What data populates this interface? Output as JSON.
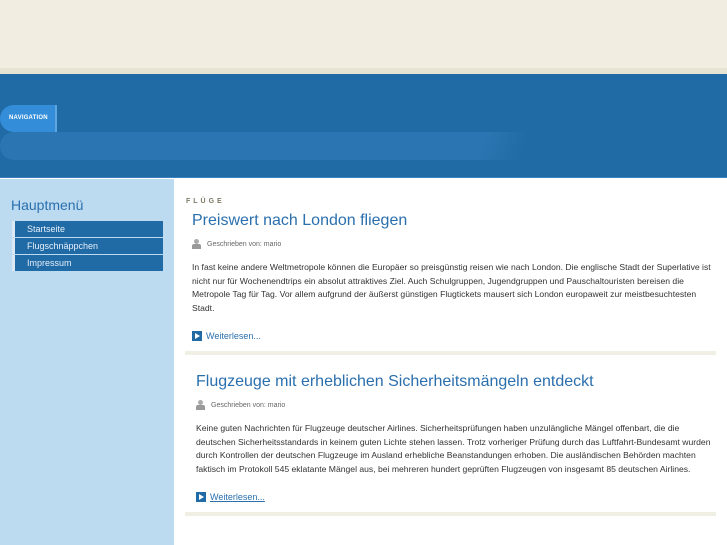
{
  "nav": {
    "label": "NAVIGATION"
  },
  "sidebar": {
    "title": "Hauptmenü",
    "items": [
      {
        "label": "Startseite"
      },
      {
        "label": "Flugschnäppchen"
      },
      {
        "label": "Impressum"
      }
    ]
  },
  "category": "FLÜGE",
  "articles": [
    {
      "title": "Preiswert nach London fliegen",
      "meta": "Geschrieben von: mario",
      "body": "In fast keine andere Weltmetropole können die Europäer so preisgünstig reisen wie nach London. Die englische Stadt der Superlative ist nicht nur für Wochenendtrips ein absolut attraktives Ziel. Auch Schulgruppen, Jugendgruppen und Pauschaltouristen bereisen die Metropole Tag für Tag. Vor allem aufgrund der äußerst günstigen Flugtickets mausert sich London europaweit zur meistbesuchtesten Stadt.",
      "more": "Weiterlesen..."
    },
    {
      "title": "Flugzeuge mit erheblichen Sicherheitsmängeln entdeckt",
      "meta": "Geschrieben von: mario",
      "body": "Keine guten Nachrichten für Flugzeuge deutscher Airlines. Sicherheitsprüfungen haben unzulängliche Mängel offenbart, die die deutschen Sicherheitsstandards in keinem guten Lichte stehen lassen. Trotz vorheriger Prüfung durch das Luftfahrt-Bundesamt wurden durch Kontrollen der deutschen Flugzeuge im Ausland erhebliche Beanstandungen erhoben. Die ausländischen Behörden machten faktisch im Protokoll 545 eklatante Mängel aus, bei mehreren hundert geprüften Flugzeugen von insgesamt 85 deutschen Airlines.",
      "more": "Weiterlesen..."
    }
  ]
}
